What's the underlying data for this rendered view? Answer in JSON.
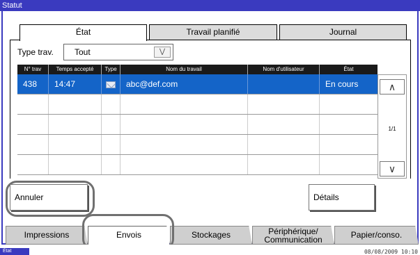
{
  "window": {
    "title": "Statut"
  },
  "tabs": [
    {
      "label": "État",
      "active": true
    },
    {
      "label": "Travail planifié",
      "active": false
    },
    {
      "label": "Journal",
      "active": false
    }
  ],
  "filter": {
    "label": "Type trav.",
    "value": "Tout",
    "dropdown_icon": "double-chevron-down-icon"
  },
  "table": {
    "columns": [
      "N° trav",
      "Temps accepté",
      "Type",
      "Nom du travail",
      "Nom d'utilisateur",
      "État"
    ],
    "rows": [
      {
        "job_no": "438",
        "time": "14:47",
        "type_icon": "mail-icon",
        "job_name": "abc@def.com",
        "user": "",
        "state": "En cours",
        "selected": true
      }
    ],
    "empty_rows": 4
  },
  "pager": {
    "indicator": "1/1",
    "up_icon": "chevron-up-icon",
    "down_icon": "chevron-down-icon"
  },
  "actions": {
    "cancel_label": "Annuler",
    "details_label": "Détails"
  },
  "bottom_tabs": [
    {
      "label": "Impressions",
      "active": false
    },
    {
      "label": "Envois",
      "active": true
    },
    {
      "label": "Stockages",
      "active": false
    },
    {
      "label": "Périphérique/ Communication",
      "line1": "Périphérique/",
      "line2": "Communication",
      "active": false
    },
    {
      "label": "Papier/conso.",
      "active": false
    }
  ],
  "status_bar": {
    "mode": "État",
    "datetime": "08/08/2009   10:10"
  },
  "colors": {
    "accent": "#3a3abf",
    "selected_row": "#1464c8",
    "header_bg": "#1a1a1a"
  }
}
